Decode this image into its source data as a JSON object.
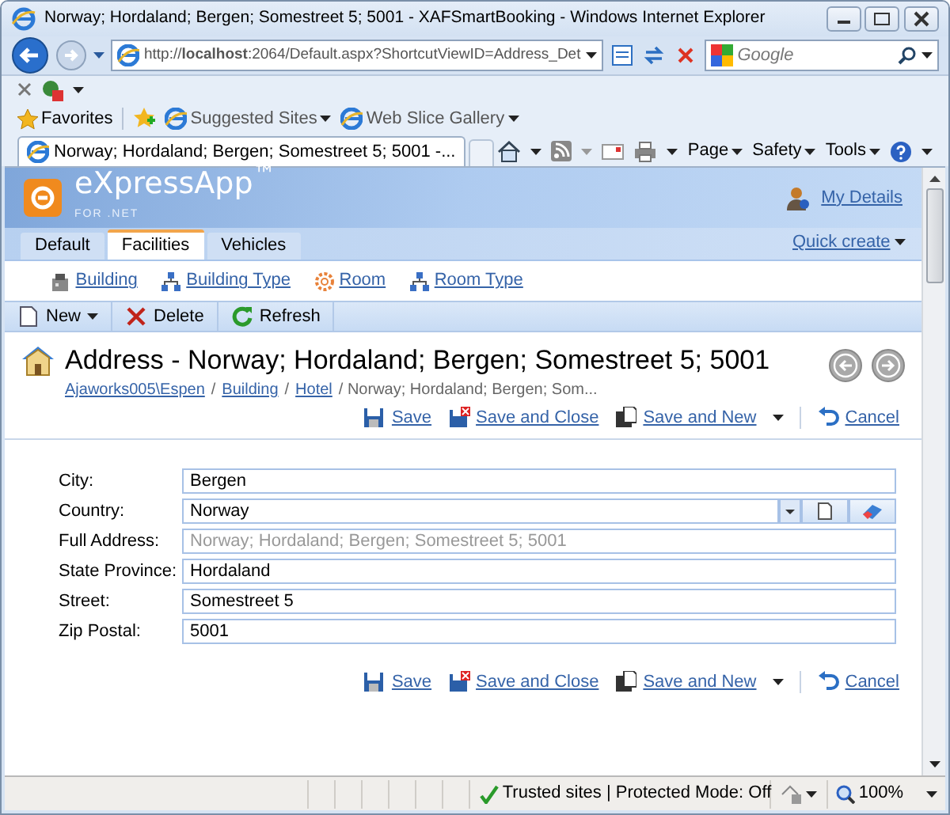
{
  "window": {
    "title": "Norway; Hordaland; Bergen; Somestreet 5; 5001 - XAFSmartBooking - Windows Internet Explorer"
  },
  "browser": {
    "address_host": "http://**localhost**:2064/Default.aspx?ShortcutViewID=Address_Det",
    "search_placeholder": "Google",
    "favorites": "Favorites",
    "links": [
      "Suggested Sites",
      "Web Slice Gallery"
    ],
    "tab": "Norway; Hordaland; Bergen; Somestreet 5; 5001 -...",
    "commands": [
      "Page",
      "Safety",
      "Tools"
    ]
  },
  "app": {
    "logo": "eXpressApp$^{™}$",
    "logo_sub": "FOR .NET",
    "user_link": "My Details",
    "tabs": [
      {
        "label": "Default",
        "selected": false
      },
      {
        "label": "Facilities",
        "selected": true
      },
      {
        "label": "Vehicles",
        "selected": false
      }
    ],
    "quick_create": "Quick create",
    "nav_links": [
      {
        "label": "Building",
        "kind": "building"
      },
      {
        "label": "Building Type",
        "kind": "type"
      },
      {
        "label": "Room",
        "kind": "room"
      },
      {
        "label": "Room Type",
        "kind": "type"
      }
    ],
    "toolbar": [
      {
        "label": "New",
        "kind": "new"
      },
      {
        "label": "Delete",
        "kind": "delete"
      },
      {
        "label": "Refresh",
        "kind": "refresh"
      }
    ],
    "title": "Address - Norway; Hordaland; Bergen; Somestreet 5; 5001",
    "breadcrumb": [
      {
        "label": "Ajaworks005\\Espen",
        "link": true
      },
      {
        "label": "/",
        "link": false
      },
      {
        "label": "Building",
        "link": true
      },
      {
        "label": "/",
        "link": false
      },
      {
        "label": "Hotel",
        "link": true
      },
      {
        "label": "/ Norway; Hordaland; Bergen; Som...",
        "link": false
      }
    ],
    "actions_top": [
      {
        "label": "Save",
        "kind": "save"
      },
      {
        "label": "Save and Close",
        "kind": "close"
      },
      {
        "label": "Save and New",
        "kind": "new"
      },
      {
        "label": "Cancel",
        "kind": "cancel"
      }
    ],
    "fields": [
      {
        "label": "City:",
        "value": "Bergen",
        "kind": "text",
        "disabled": false
      },
      {
        "label": "Country:",
        "value": "Norway",
        "kind": "lookup",
        "disabled": false
      },
      {
        "label": "Full Address:",
        "value": "Norway; Hordaland; Bergen; Somestreet 5; 5001",
        "kind": "text",
        "disabled": true
      },
      {
        "label": "State Province:",
        "value": "Hordaland",
        "kind": "text",
        "disabled": false
      },
      {
        "label": "Street:",
        "value": "Somestreet 5",
        "kind": "text",
        "disabled": false
      },
      {
        "label": "Zip Postal:",
        "value": "5001",
        "kind": "text",
        "disabled": false
      }
    ],
    "actions_bottom": [
      {
        "label": "Save",
        "kind": "save"
      },
      {
        "label": "Save and Close",
        "kind": "close"
      },
      {
        "label": "Save and New",
        "kind": "new"
      },
      {
        "label": "Cancel",
        "kind": "cancel"
      }
    ]
  },
  "status": {
    "zone": "Trusted sites | Protected Mode: Off",
    "zoom": "100%"
  }
}
